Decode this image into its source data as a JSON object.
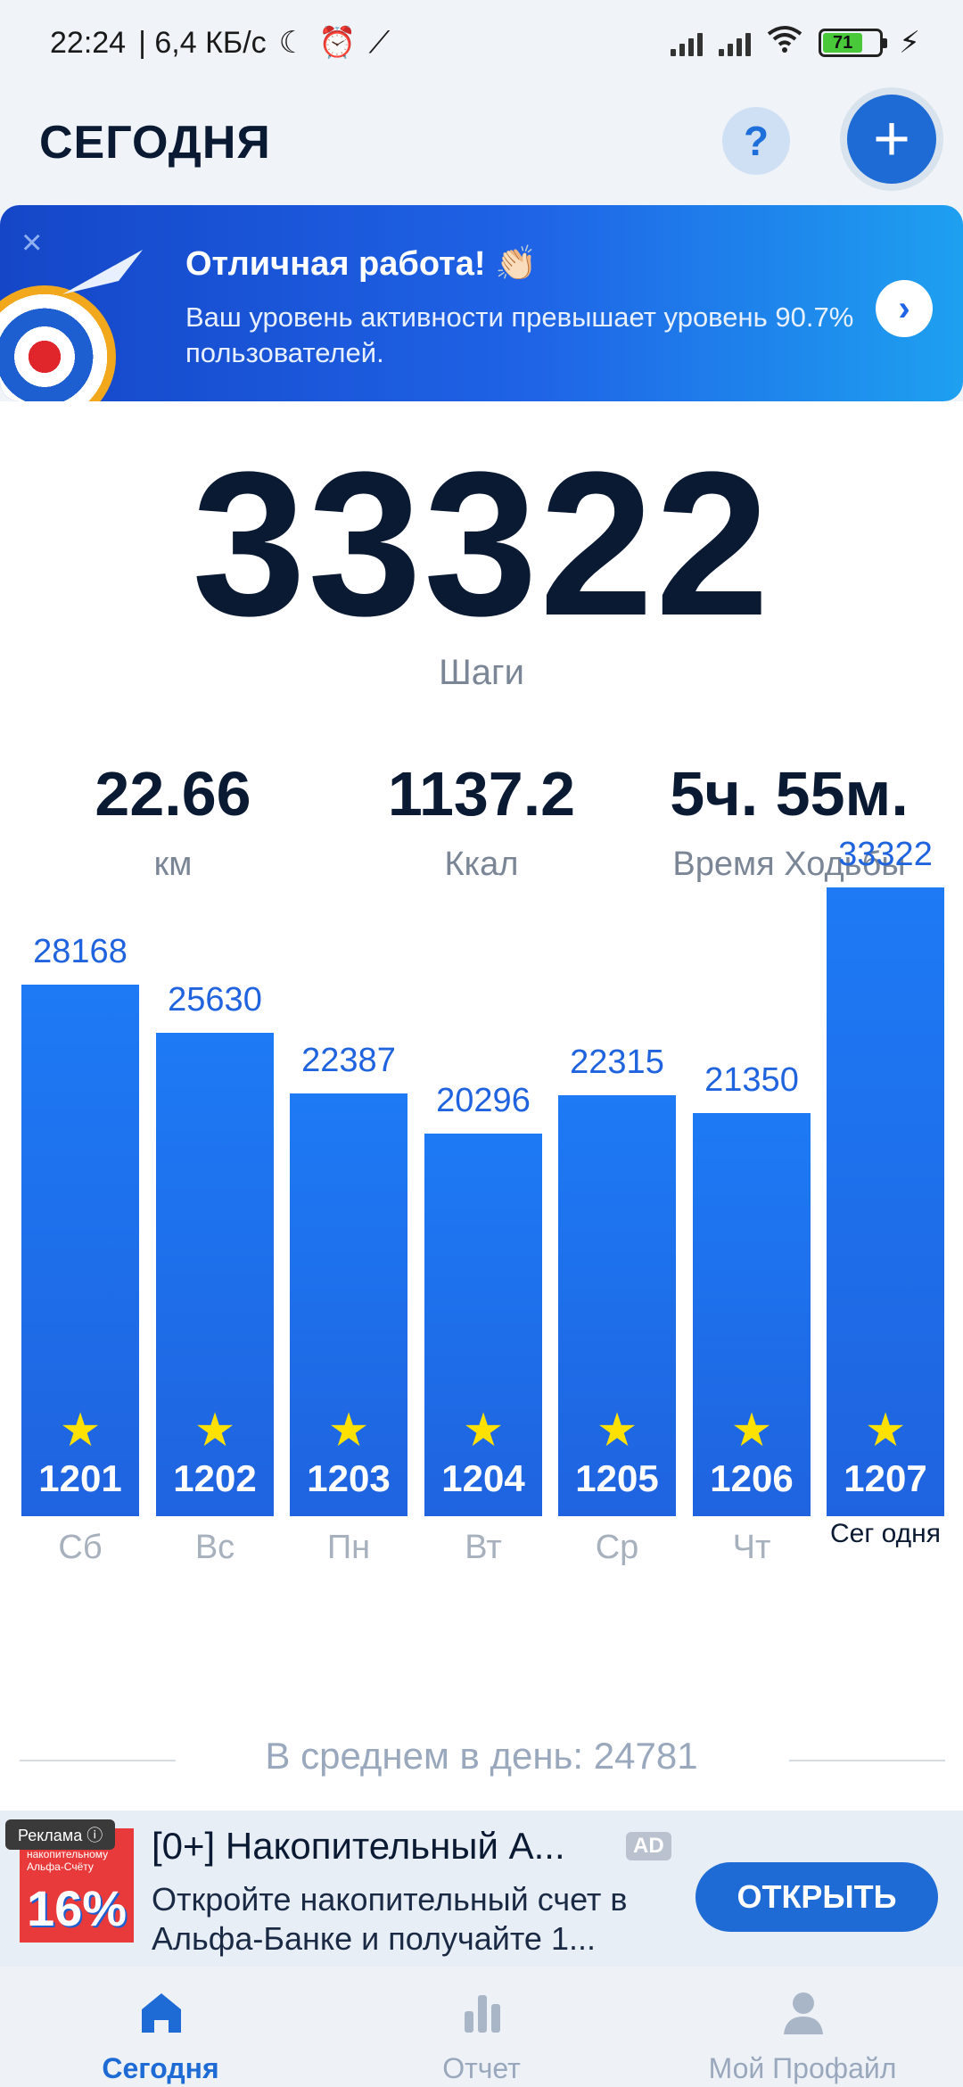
{
  "status_bar": {
    "time": "22:24",
    "speed": "| 6,4 КБ/с",
    "battery": "71"
  },
  "header": {
    "title": "СЕГОДНЯ",
    "help_label": "?",
    "add_label": "+"
  },
  "banner": {
    "close": "×",
    "title": "Отличная работа! 👏🏻",
    "text": "Ваш уровень активности превышает уровень 90.7% пользователей.",
    "go": "›"
  },
  "main": {
    "steps": "33322",
    "steps_label": "Шаги",
    "stats": [
      {
        "value": "22.66",
        "label": "км"
      },
      {
        "value": "1137.2",
        "label": "Ккал"
      },
      {
        "value": "5ч. 55м.",
        "label": "Время Ходьбы"
      }
    ]
  },
  "chart_data": {
    "type": "bar",
    "categories": [
      "Сб",
      "Вс",
      "Пн",
      "Вт",
      "Ср",
      "Чт",
      "Сег одня"
    ],
    "values": [
      28168,
      25630,
      22387,
      20296,
      22315,
      21350,
      33322
    ],
    "bar_badges": [
      "1201",
      "1202",
      "1203",
      "1204",
      "1205",
      "1206",
      "1207"
    ],
    "star": "★",
    "title": "",
    "xlabel": "",
    "ylabel": ""
  },
  "average": {
    "text": "В среднем в день: 24781"
  },
  "ad": {
    "badge": "Реклама ⓘ",
    "thumb_text": "16% по накопительному Альфа-Счёту",
    "thumb_pct": "16%",
    "headline": "[0+] Накопительный А...",
    "ad_tag": "AD",
    "body": "Откройте накопительный счет в Альфа-Банке и получайте 1...",
    "cta": "ОТКРЫТЬ"
  },
  "nav": {
    "items": [
      {
        "label": "Сегодня",
        "active": true
      },
      {
        "label": "Отчет",
        "active": false
      },
      {
        "label": "Мой Профайл",
        "active": false
      }
    ]
  },
  "colors": {
    "accent": "#1e6bd6",
    "bar": "#1f63df",
    "star": "#ffe100",
    "text_dark": "#0b1a33"
  }
}
